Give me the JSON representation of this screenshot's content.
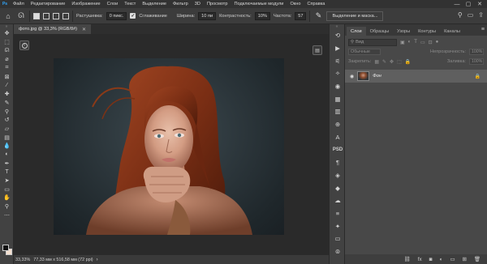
{
  "menu": {
    "logo": "Ps",
    "items": [
      "Файл",
      "Редактирование",
      "Изображение",
      "Слои",
      "Текст",
      "Выделение",
      "Фильтр",
      "3D",
      "Просмотр",
      "Подключаемые модули",
      "Окно",
      "Справка"
    ],
    "window_controls": [
      "—",
      "▢",
      "✕"
    ]
  },
  "options": {
    "feather_label": "Растушевка:",
    "feather_value": "0 пикс.",
    "smoothing_label": "Сглаживание",
    "width_label": "Ширина:",
    "width_value": "10 пи",
    "contrast_label": "Контрастность:",
    "contrast_value": "10%",
    "frequency_label": "Частота:",
    "frequency_value": "57",
    "select_mask_button": "Выделение и маска..."
  },
  "document": {
    "tab_title": "фото.jpg @ 33,3% (RGB/8#)",
    "close_glyph": "✕"
  },
  "status": {
    "zoom": "33,33%",
    "dimensions": "77,33 мм x 516,58 мм (72 ppi)",
    "arrow": "›"
  },
  "toolbar": {
    "tools": [
      {
        "name": "move-tool",
        "glyph": "✥"
      },
      {
        "name": "marquee-tool",
        "glyph": "⬚"
      },
      {
        "name": "lasso-tool",
        "glyph": "ᘏ"
      },
      {
        "name": "quick-select-tool",
        "glyph": "⌀"
      },
      {
        "name": "crop-tool",
        "glyph": "⌗"
      },
      {
        "name": "frame-tool",
        "glyph": "⊠"
      },
      {
        "name": "eyedropper-tool",
        "glyph": "⁄"
      },
      {
        "name": "healing-brush-tool",
        "glyph": "✚"
      },
      {
        "name": "brush-tool",
        "glyph": "✎"
      },
      {
        "name": "clone-stamp-tool",
        "glyph": "⚲"
      },
      {
        "name": "history-brush-tool",
        "glyph": "↺"
      },
      {
        "name": "eraser-tool",
        "glyph": "▱"
      },
      {
        "name": "gradient-tool",
        "glyph": "▤"
      },
      {
        "name": "blur-tool",
        "glyph": "💧"
      },
      {
        "name": "dodge-tool",
        "glyph": "◐"
      },
      {
        "name": "pen-tool",
        "glyph": "✒"
      },
      {
        "name": "type-tool",
        "glyph": "T"
      },
      {
        "name": "path-select-tool",
        "glyph": "➤"
      },
      {
        "name": "shape-tool",
        "glyph": "▭"
      },
      {
        "name": "hand-tool",
        "glyph": "✋"
      },
      {
        "name": "zoom-tool",
        "glyph": "⚲"
      },
      {
        "name": "more-tools",
        "glyph": "⋯"
      }
    ]
  },
  "dock": {
    "buttons": [
      {
        "name": "history-icon",
        "glyph": "⟲"
      },
      {
        "name": "play-icon",
        "glyph": "▶"
      },
      {
        "name": "mixer-icon",
        "glyph": "⚟"
      },
      {
        "name": "learn-icon",
        "glyph": "✧"
      },
      {
        "name": "color-wheel-icon",
        "glyph": "◉"
      },
      {
        "name": "swatches-icon",
        "glyph": "▦"
      },
      {
        "name": "gradient-panel-icon",
        "glyph": "▥"
      },
      {
        "name": "paths-icon",
        "glyph": "⊕"
      },
      {
        "name": "char-icon",
        "glyph": "A"
      },
      {
        "name": "paragraph-icon",
        "glyph": "¶"
      },
      {
        "name": "adjust-icon",
        "glyph": "◈"
      },
      {
        "name": "layer-comps-icon",
        "glyph": "◆"
      },
      {
        "name": "libraries-icon",
        "glyph": "☁"
      },
      {
        "name": "properties-icon",
        "glyph": "≡"
      },
      {
        "name": "three-d-icon",
        "glyph": "✦"
      },
      {
        "name": "timeline-icon",
        "glyph": "▭"
      },
      {
        "name": "notes-icon",
        "glyph": "⊚"
      }
    ],
    "psd_label": "PSD"
  },
  "layers_panel": {
    "tabs": [
      "Слои",
      "Образцы",
      "Узоры",
      "Контуры",
      "Каналы"
    ],
    "active_tab": 0,
    "search_placeholder": "Вид",
    "blend_mode": "Обычные",
    "opacity_label": "Непрозрачность:",
    "opacity_value": "100%",
    "lock_label": "Закрепить:",
    "fill_label": "Заливка:",
    "fill_value": "100%",
    "layers": [
      {
        "name": "Фон",
        "visible": true,
        "locked": true
      }
    ],
    "footer_icons": [
      "link-icon",
      "fx-icon",
      "mask-icon",
      "adjustment-icon",
      "group-icon",
      "new-layer-icon",
      "trash-icon"
    ],
    "footer_glyphs": [
      "⛓",
      "fx",
      "◙",
      "◐",
      "▭",
      "⊞",
      "🗑"
    ]
  }
}
